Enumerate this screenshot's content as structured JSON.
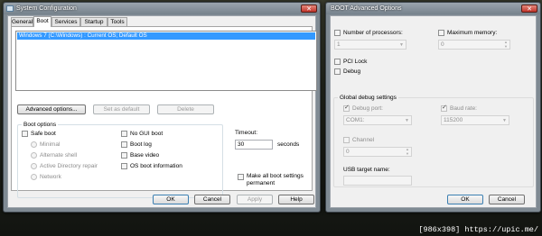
{
  "syscfg": {
    "title": "System Configuration",
    "close_glyph": "✕",
    "tabs": [
      "General",
      "Boot",
      "Services",
      "Startup",
      "Tools"
    ],
    "boot_entry": "Windows 7 (C:\\Windows) : Current OS; Default OS",
    "buttons": {
      "advanced": "Advanced options...",
      "set_default": "Set as default",
      "delete": "Delete"
    },
    "boot_options": {
      "group_label": "Boot options",
      "safe_boot": "Safe boot",
      "minimal": "Minimal",
      "alternate_shell": "Alternate shell",
      "active_directory_repair": "Active Directory repair",
      "network": "Network",
      "no_gui_boot": "No GUI boot",
      "boot_log": "Boot log",
      "base_video": "Base video",
      "os_boot_information": "OS boot information"
    },
    "timeout": {
      "label": "Timeout:",
      "value": "30",
      "unit": "seconds"
    },
    "make_permanent": "Make all boot settings permanent",
    "footer_buttons": {
      "ok": "OK",
      "cancel": "Cancel",
      "apply": "Apply",
      "help": "Help"
    }
  },
  "advanced": {
    "title": "BOOT Advanced Options",
    "close_glyph": "✕",
    "num_processors": {
      "label": "Number of processors:",
      "value": "1"
    },
    "max_memory": {
      "label": "Maximum memory:",
      "value": "0"
    },
    "pci_lock": "PCI Lock",
    "debug": "Debug",
    "global_debug": {
      "group_label": "Global debug settings",
      "debug_port": {
        "label": "Debug port:",
        "value": "COM1:",
        "checked": true
      },
      "baud_rate": {
        "label": "Baud rate:",
        "value": "115200",
        "checked": true
      },
      "channel": {
        "label": "Channel",
        "value": "0"
      },
      "usb_target": {
        "label": "USB target name:",
        "value": ""
      }
    },
    "footer_buttons": {
      "ok": "OK",
      "cancel": "Cancel"
    }
  },
  "watermark": "[986x398] https://upic.me/"
}
